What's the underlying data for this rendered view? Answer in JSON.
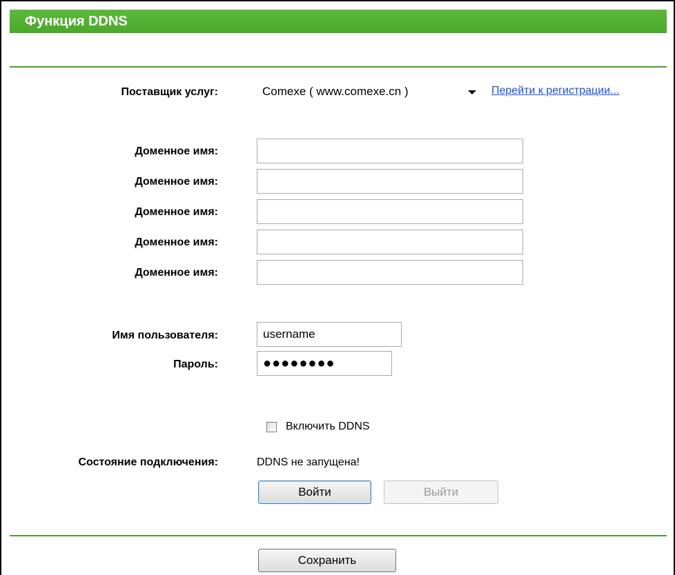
{
  "header": {
    "title": "Функция DDNS"
  },
  "provider": {
    "label": "Поставщик услуг:",
    "selected": "Comexe ( www.comexe.cn )",
    "register_link": "Перейти к регистрации..."
  },
  "domains": [
    {
      "label": "Доменное имя:",
      "value": ""
    },
    {
      "label": "Доменное имя:",
      "value": ""
    },
    {
      "label": "Доменное имя:",
      "value": ""
    },
    {
      "label": "Доменное имя:",
      "value": ""
    },
    {
      "label": "Доменное имя:",
      "value": ""
    }
  ],
  "username": {
    "label": "Имя пользователя:",
    "value": "username"
  },
  "password": {
    "label": "Пароль:",
    "masked_value": "●●●●●●●●"
  },
  "enable": {
    "label": "Включить DDNS",
    "checked": false
  },
  "status": {
    "label": "Состояние подключения:",
    "value": "DDNS не запущена!"
  },
  "buttons": {
    "login": "Войти",
    "logout": "Выйти",
    "save": "Сохранить"
  },
  "colors": {
    "accent": "#4aa92a",
    "link": "#1a4fd6"
  }
}
